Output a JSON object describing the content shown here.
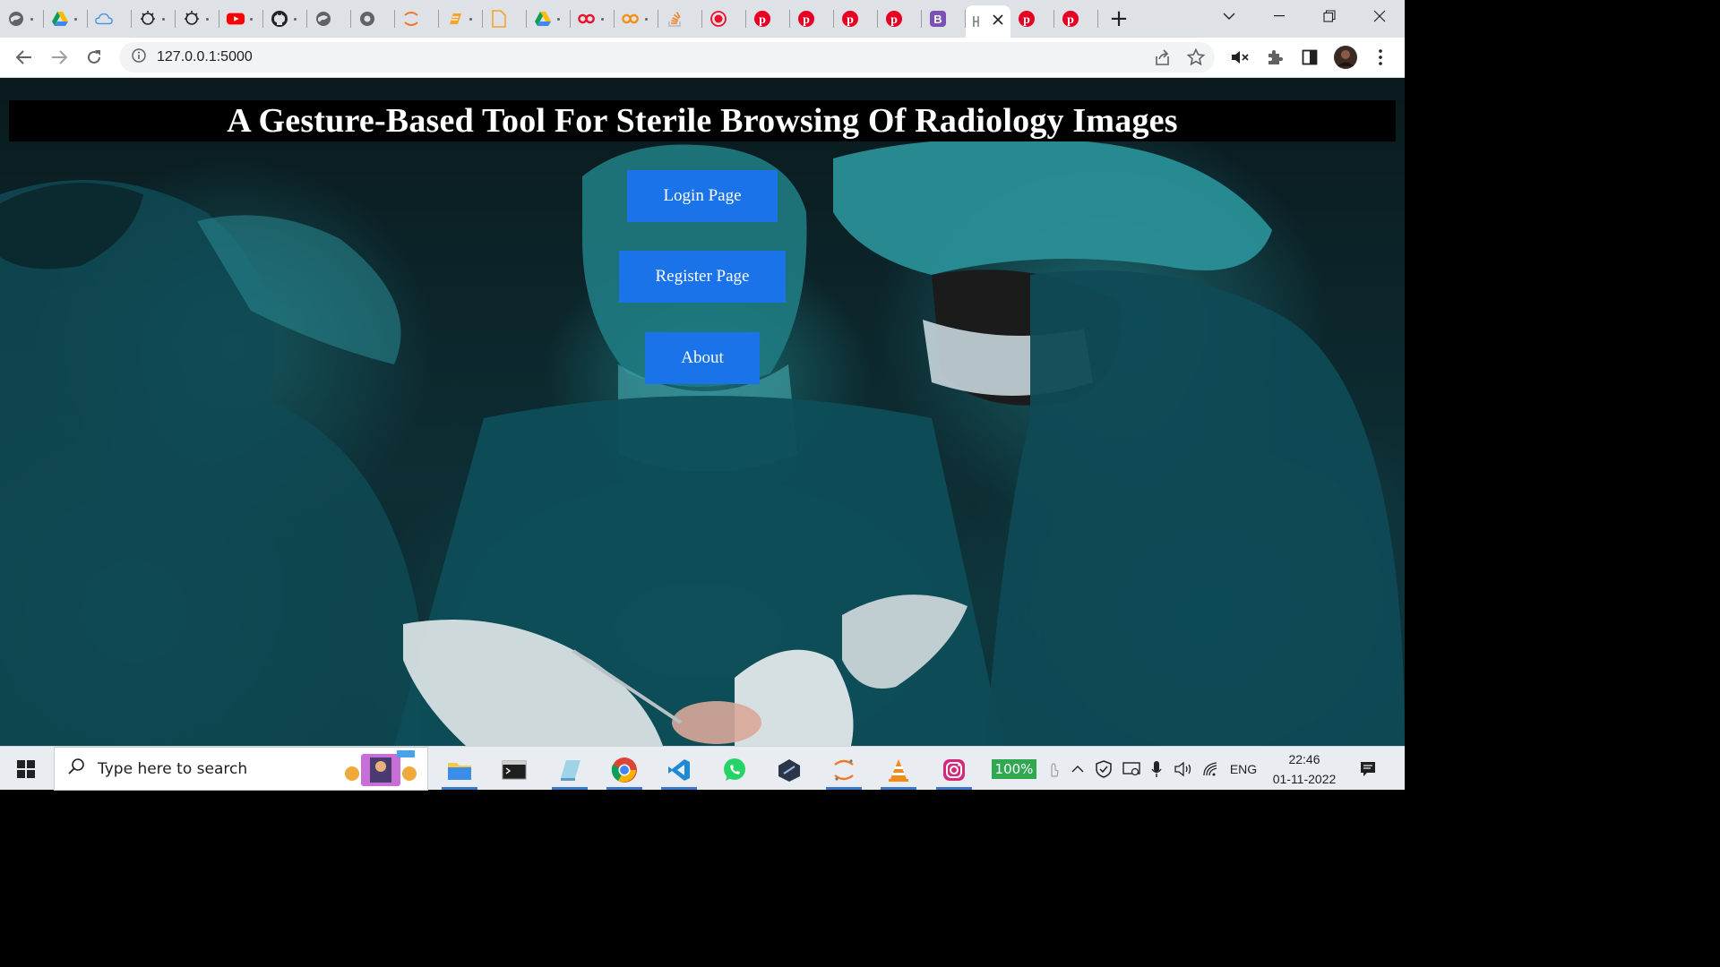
{
  "browser": {
    "tabs": [
      {
        "icon": "globe-icon"
      },
      {
        "icon": "google-drive-icon"
      },
      {
        "icon": "cloud-icon"
      },
      {
        "icon": "bulb-icon"
      },
      {
        "icon": "bulb-icon"
      },
      {
        "icon": "youtube-icon"
      },
      {
        "icon": "github-icon"
      },
      {
        "icon": "globe-icon"
      },
      {
        "icon": "chrome-ext-icon"
      },
      {
        "icon": "jupyter-icon"
      },
      {
        "icon": "docs-icon"
      },
      {
        "icon": "file-icon"
      },
      {
        "icon": "google-drive-icon"
      },
      {
        "icon": "infinity-red-icon"
      },
      {
        "icon": "infinity-orange-icon"
      },
      {
        "icon": "stack-overflow-icon"
      },
      {
        "icon": "record-icon"
      },
      {
        "icon": "pinterest-icon"
      },
      {
        "icon": "pinterest-icon"
      },
      {
        "icon": "pinterest-icon"
      },
      {
        "icon": "pinterest-icon"
      },
      {
        "icon": "bootstrap-icon"
      },
      {
        "icon": "page-icon",
        "active": true
      },
      {
        "icon": "pinterest-icon"
      },
      {
        "icon": "pinterest-icon"
      }
    ],
    "address": {
      "url": "127.0.0.1:5000"
    }
  },
  "page": {
    "title": "A Gesture-Based Tool For Sterile Browsing Of Radiology Images",
    "buttons": {
      "login": "Login Page",
      "register": "Register Page",
      "about": "About"
    }
  },
  "taskbar": {
    "search_placeholder": "Type here to search",
    "battery": "100%",
    "language": "ENG",
    "time": "22:46",
    "date": "01-11-2022"
  },
  "colors": {
    "button_bg": "#1a73e8",
    "title_bar_bg": "#000000",
    "title_text": "#ffffff"
  }
}
